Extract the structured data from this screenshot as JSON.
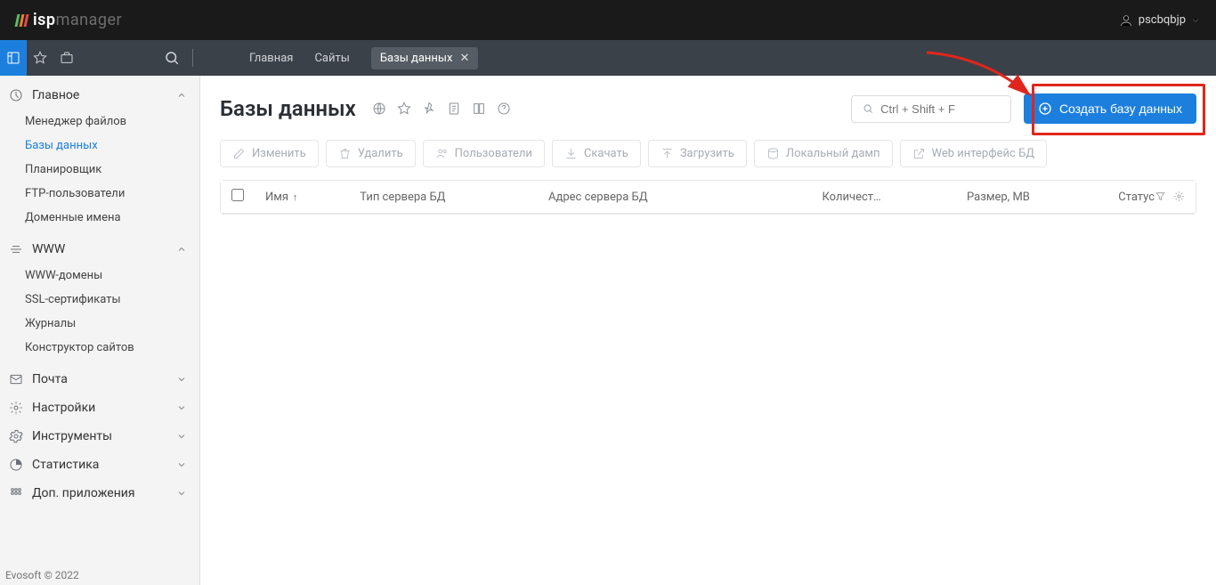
{
  "header": {
    "logo_a": "isp",
    "logo_b": "manager",
    "username": "pscbqbjp"
  },
  "breadcrumbs": {
    "home": "Главная",
    "sites": "Сайты",
    "active_tab": "Базы данных"
  },
  "sidebar": {
    "groups": [
      {
        "label": "Главное",
        "expanded": true,
        "items": [
          {
            "label": "Менеджер файлов"
          },
          {
            "label": "Базы данных",
            "active": true
          },
          {
            "label": "Планировщик"
          },
          {
            "label": "FTP-пользователи"
          },
          {
            "label": "Доменные имена"
          }
        ]
      },
      {
        "label": "WWW",
        "expanded": true,
        "items": [
          {
            "label": "WWW-домены"
          },
          {
            "label": "SSL-сертификаты"
          },
          {
            "label": "Журналы"
          },
          {
            "label": "Конструктор сайтов"
          }
        ]
      },
      {
        "label": "Почта",
        "expanded": false
      },
      {
        "label": "Настройки",
        "expanded": false
      },
      {
        "label": "Инструменты",
        "expanded": false
      },
      {
        "label": "Статистика",
        "expanded": false
      },
      {
        "label": "Доп. приложения",
        "expanded": false
      }
    ]
  },
  "page": {
    "title": "Базы данных",
    "search_placeholder": "Ctrl + Shift + F",
    "create_btn": "Создать базу данных"
  },
  "toolbar": [
    "Изменить",
    "Удалить",
    "Пользователи",
    "Скачать",
    "Загрузить",
    "Локальный дамп",
    "Web интерфейс БД"
  ],
  "table": {
    "cols": {
      "name": "Имя",
      "server_type": "Тип сервера БД",
      "server_addr": "Адрес сервера БД",
      "count": "Количест…",
      "size": "Размер, MB",
      "status": "Статус"
    }
  },
  "footer": "Evosoft © 2022"
}
